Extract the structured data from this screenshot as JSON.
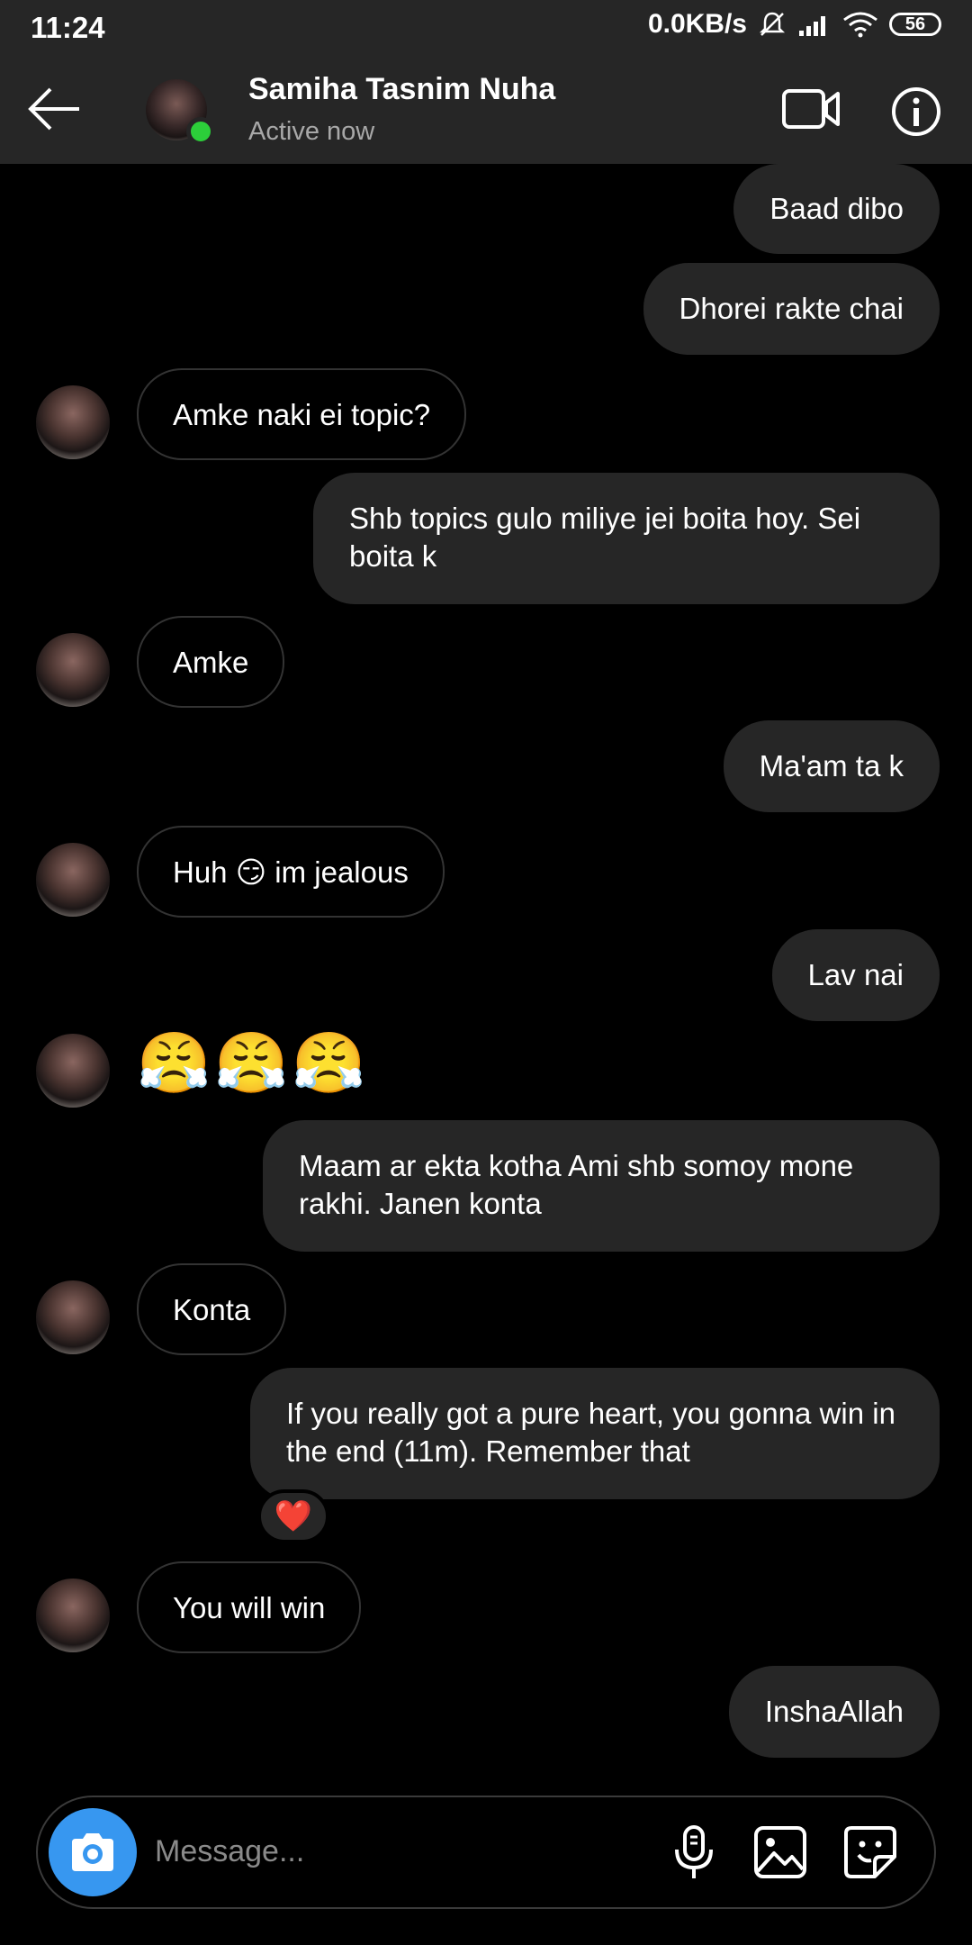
{
  "status_bar": {
    "time": "11:24",
    "net_speed": "0.0KB/s",
    "battery": "56"
  },
  "header": {
    "contact_name": "Samiha Tasnim Nuha",
    "contact_status": "Active now"
  },
  "messages": [
    {
      "dir": "out",
      "text": "Baad dibo"
    },
    {
      "dir": "out",
      "text": "Dhorei rakte chai"
    },
    {
      "dir": "in",
      "text": "Amke naki ei topic?"
    },
    {
      "dir": "out",
      "text": "Shb topics gulo miliye jei boita hoy. Sei boita k"
    },
    {
      "dir": "in",
      "text": "Amke"
    },
    {
      "dir": "out",
      "text": "Ma'am ta k"
    },
    {
      "dir": "in",
      "text": "Huh 😏 im jealous"
    },
    {
      "dir": "out",
      "text": "Lav nai"
    },
    {
      "dir": "in",
      "text": "😤😤😤"
    },
    {
      "dir": "out",
      "text": "Maam ar ekta kotha Ami shb somoy mone rakhi. Janen konta"
    },
    {
      "dir": "in",
      "text": "Konta"
    },
    {
      "dir": "out",
      "text": "If you really got a pure heart, you gonna win in the end (11m). Remember that",
      "reaction": "❤️"
    },
    {
      "dir": "in",
      "text": "You will win"
    },
    {
      "dir": "out",
      "text": "InshaAllah"
    }
  ],
  "composer": {
    "placeholder": "Message..."
  }
}
